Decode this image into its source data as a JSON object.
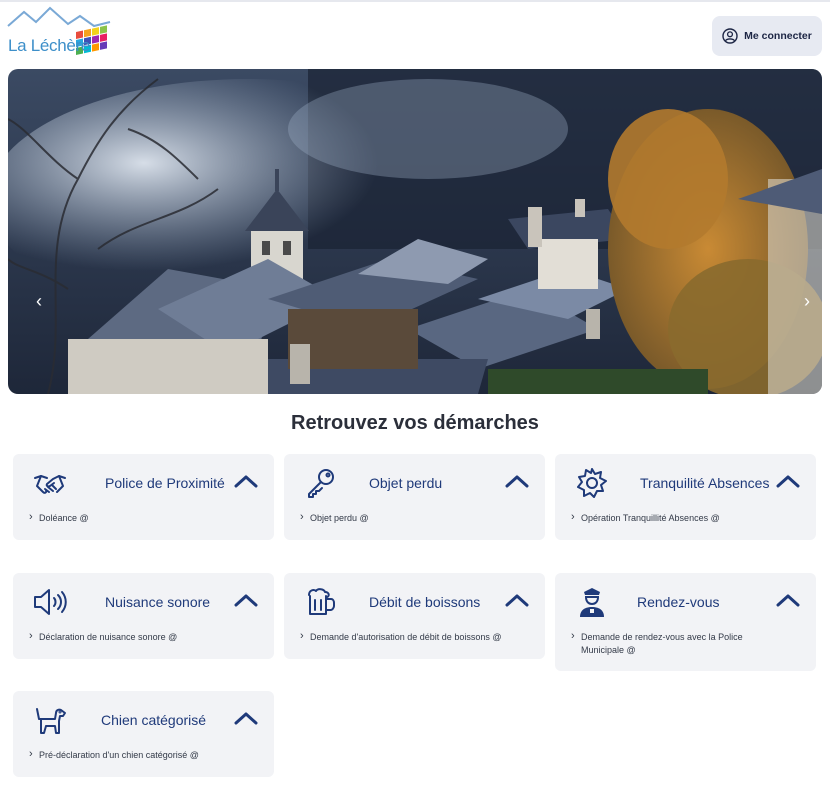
{
  "header": {
    "logo_text": "La Léchère",
    "login_label": "Me connecter"
  },
  "hero": {
    "prev_label": "‹",
    "next_label": "›"
  },
  "section": {
    "title": "Retrouvez vos démarches"
  },
  "cards": [
    {
      "title": "Police de Proximité",
      "icon": "handshake-icon",
      "link": "Doléance @"
    },
    {
      "title": "Objet perdu",
      "icon": "key-icon",
      "link": "Objet perdu @"
    },
    {
      "title": "Tranquilité Absences",
      "icon": "badge-icon",
      "link": "Opération Tranquillité Absences @"
    },
    {
      "title": "Nuisance sonore",
      "icon": "speaker-icon",
      "link": "Déclaration de nuisance sonore @"
    },
    {
      "title": "Débit de boissons",
      "icon": "beer-mug-icon",
      "link": "Demande d'autorisation de débit de boissons @"
    },
    {
      "title": "Rendez-vous",
      "icon": "police-officer-icon",
      "link": "Demande de rendez-vous avec la Police Municipale @"
    },
    {
      "title": "Chien catégorisé",
      "icon": "dog-icon",
      "link": "Pré-déclaration d'un chien catégorisé @"
    }
  ],
  "colors": {
    "accent": "#1f3a7a",
    "card_bg": "#f2f3f6",
    "button_bg": "#e7eaf2"
  }
}
